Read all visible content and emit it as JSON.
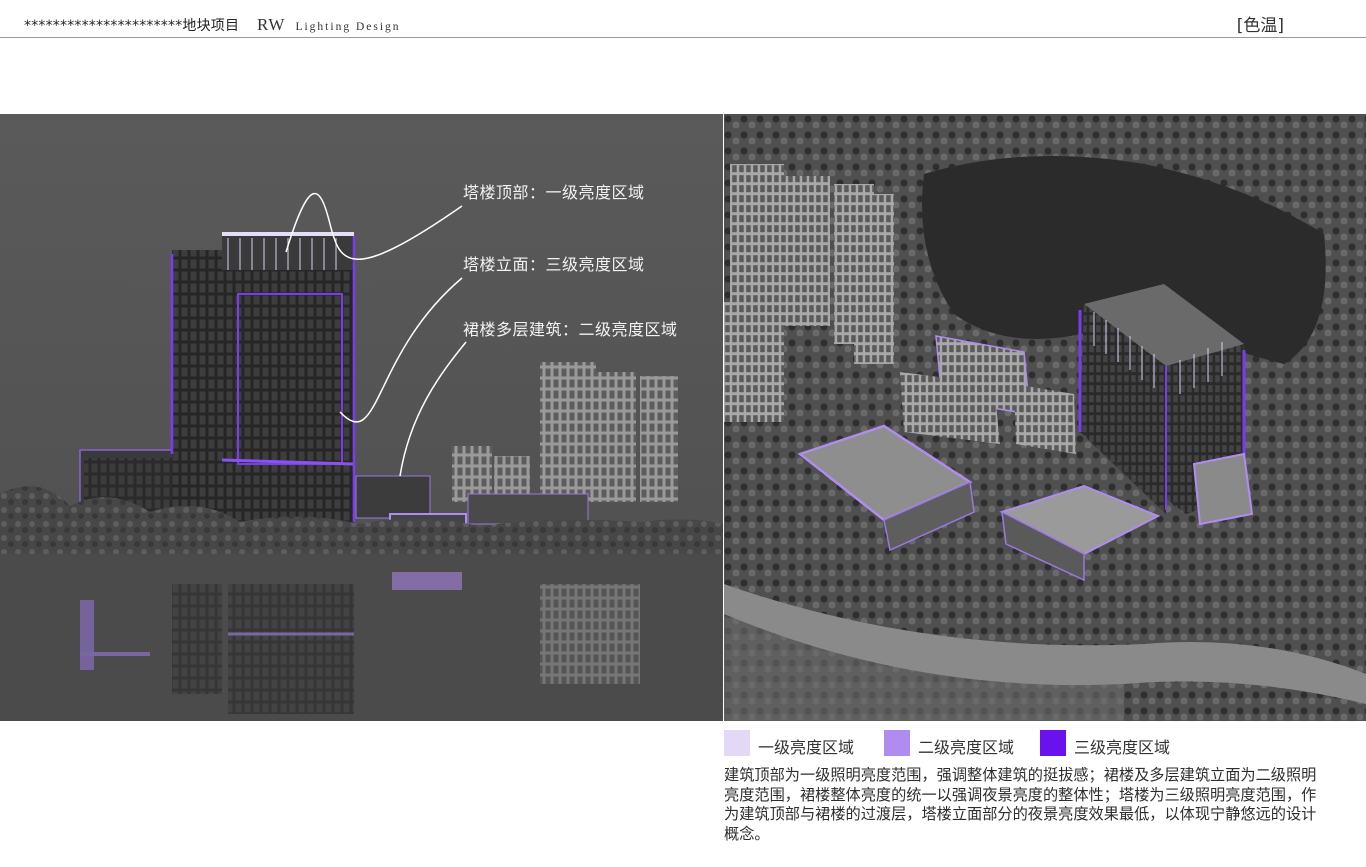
{
  "header": {
    "project": "**********************地块项目",
    "brand_rw": "RW",
    "brand_lighting": "Lighting Design",
    "tag": "[色温]"
  },
  "callouts": [
    "塔楼顶部：一级亮度区域",
    "塔楼立面：三级亮度区域",
    "裙楼多层建筑：二级亮度区域"
  ],
  "legend": [
    {
      "label": "一级亮度区域",
      "color": "#e3d9f7"
    },
    {
      "label": "二级亮度区域",
      "color": "#b18cf0"
    },
    {
      "label": "三级亮度区域",
      "color": "#6a12ee"
    }
  ],
  "description": "建筑顶部为一级照明亮度范围，强调整体建筑的挺拔感；裙楼及多层建筑立面为二级照明亮度范围，裙楼整体亮度的统一以强调夜景亮度的整体性；塔楼为三级照明亮度范围，作为建筑顶部与裙楼的过渡层，塔楼立面部分的夜景亮度效果最低，以体现宁静悠远的设计概念。"
}
